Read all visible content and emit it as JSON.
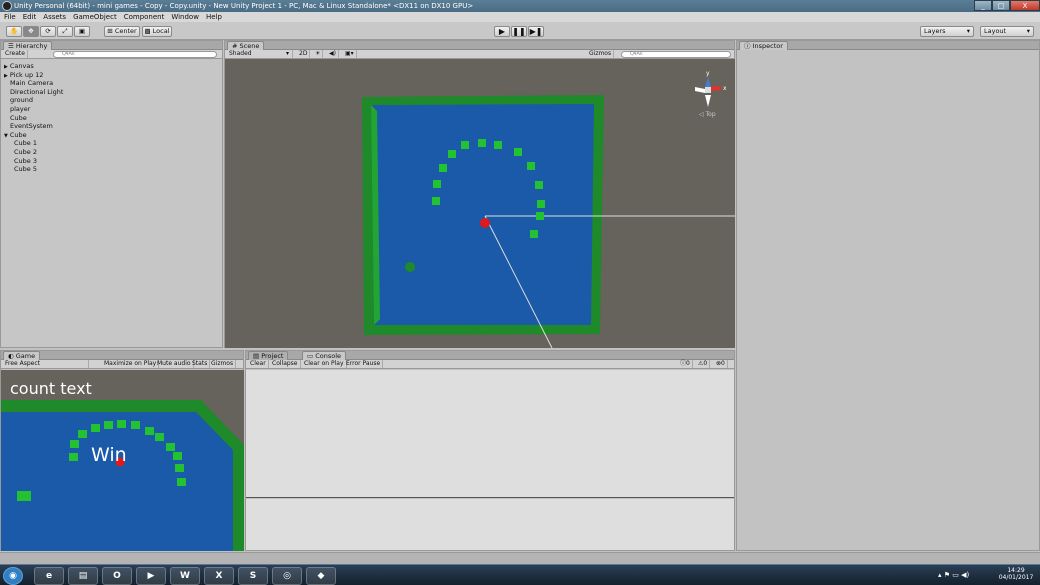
{
  "window": {
    "title": "Unity Personal (64bit) - mini games - Copy - Copy.unity - New Unity Project 1 - PC, Mac & Linux Standalone* <DX11 on DX10 GPU>",
    "controls": [
      "_",
      "□",
      "X"
    ]
  },
  "menu": [
    "File",
    "Edit",
    "Assets",
    "GameObject",
    "Component",
    "Window",
    "Help"
  ],
  "toolbar": {
    "tools": [
      "✋",
      "✥",
      "⟳",
      "⤢",
      "▣"
    ],
    "center_label": "Center",
    "local_label": "Local",
    "play_icons": [
      "▶",
      "❚❚",
      "▶❚"
    ],
    "layers_label": "Layers",
    "layout_label": "Layout"
  },
  "hierarchy": {
    "tab": "Hierarchy",
    "create": "Create",
    "search_placeholder": "Q▾All",
    "items": [
      {
        "label": "Canvas",
        "indent": 0,
        "arrow": "▶"
      },
      {
        "label": "Pick up 12",
        "indent": 0,
        "arrow": "▶"
      },
      {
        "label": "Main Camera",
        "indent": 1,
        "arrow": ""
      },
      {
        "label": "Directional Light",
        "indent": 1,
        "arrow": ""
      },
      {
        "label": "ground",
        "indent": 1,
        "arrow": ""
      },
      {
        "label": "player",
        "indent": 1,
        "arrow": ""
      },
      {
        "label": "Cube",
        "indent": 1,
        "arrow": ""
      },
      {
        "label": "EventSystem",
        "indent": 1,
        "arrow": ""
      },
      {
        "label": "Cube",
        "indent": 0,
        "arrow": "▼"
      },
      {
        "label": "Cube 1",
        "indent": 2,
        "arrow": ""
      },
      {
        "label": "Cube 2",
        "indent": 2,
        "arrow": ""
      },
      {
        "label": "Cube 3",
        "indent": 2,
        "arrow": ""
      },
      {
        "label": "Cube 5",
        "indent": 2,
        "arrow": ""
      }
    ]
  },
  "scene": {
    "tab": "Scene",
    "shaded": "Shaded",
    "btn_2d": "2D",
    "gizmos": "Gizmos",
    "search_placeholder": "Q▾All",
    "gizmo_label": "◁ Top",
    "axis_y": "y",
    "axis_x": "x"
  },
  "game": {
    "tab": "Game",
    "aspect": "Free Aspect",
    "buttons": [
      "Maximize on Play",
      "Mute audio",
      "Stats",
      "Gizmos"
    ],
    "count_text": "count text",
    "win_text": "Win"
  },
  "project_tab": "Project",
  "console": {
    "tab": "Console",
    "buttons": [
      "Clear",
      "Collapse",
      "Clear on Play",
      "Error Pause"
    ],
    "counts": [
      "0",
      "0",
      "0"
    ]
  },
  "inspector": {
    "tab": "Inspector"
  },
  "taskbar": {
    "apps": [
      "start-orb",
      "internet-explorer",
      "file-explorer",
      "outlook",
      "media-player",
      "word",
      "excel",
      "skype",
      "chrome",
      "unity"
    ],
    "app_glyphs": [
      "◉",
      "e",
      "▤",
      "O",
      "▶",
      "W",
      "X",
      "S",
      "◎",
      "◆"
    ],
    "tray_icons": "▴ ⚑ ▭ ◀)",
    "time": "14:29",
    "date": "04/01/2017"
  },
  "colors": {
    "ground_blue": "#1a5aa8",
    "border_green": "#1f8a2a",
    "pickup_green": "#22c233",
    "player_red": "#e0191c",
    "scene_bg": "#66625c"
  }
}
